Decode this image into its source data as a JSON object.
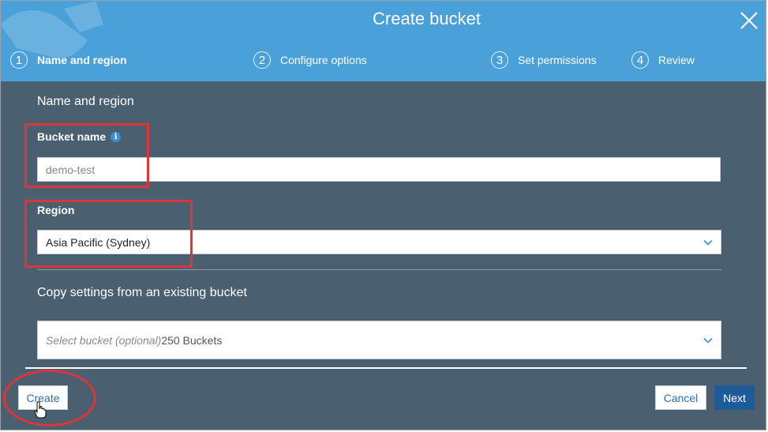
{
  "dialog": {
    "title": "Create bucket"
  },
  "steps": [
    {
      "number": "1",
      "label": "Name and region",
      "active": true
    },
    {
      "number": "2",
      "label": "Configure options",
      "active": false
    },
    {
      "number": "3",
      "label": "Set permissions",
      "active": false
    },
    {
      "number": "4",
      "label": "Review",
      "active": false
    }
  ],
  "form": {
    "section_title": "Name and region",
    "bucket_name": {
      "label": "Bucket name",
      "placeholder": "demo-test",
      "value": ""
    },
    "region": {
      "label": "Region",
      "selected": "Asia Pacific (Sydney)"
    },
    "copy_settings": {
      "title": "Copy settings from an existing bucket",
      "placeholder": "Select bucket (optional)",
      "count": "250 Buckets"
    }
  },
  "footer": {
    "create_label": "Create",
    "cancel_label": "Cancel",
    "next_label": "Next"
  },
  "icons": {
    "close": "close-icon",
    "info": "info-icon",
    "chevron": "chevron-down-icon",
    "cursor": "hand-pointer-icon"
  },
  "colors": {
    "header": "#4aa0d8",
    "body": "#4a6070",
    "primary_button": "#1f5b9a",
    "link": "#2b6fb0",
    "highlight": "#e0333a"
  }
}
